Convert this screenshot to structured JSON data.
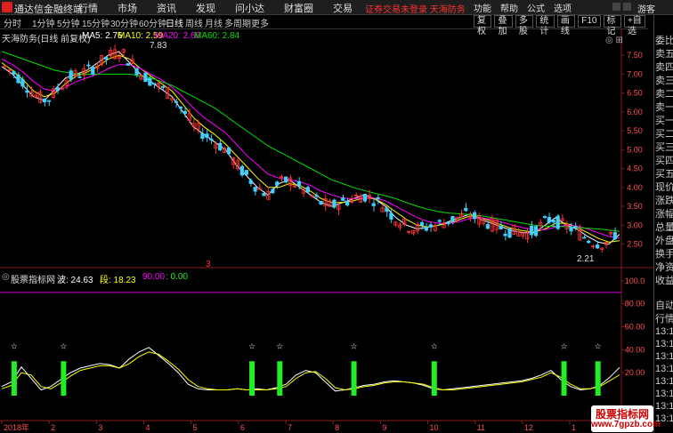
{
  "titlebar": {
    "app_title": "通达信金融终端",
    "menu": [
      "行情",
      "市场",
      "资讯",
      "发现",
      "问小达",
      "财富圈",
      "交易"
    ],
    "notice": "证券交易未登录 天海防务",
    "func": [
      "功能",
      "帮助",
      "公式",
      "选项"
    ],
    "guest": "游客"
  },
  "toolbar": {
    "periods": [
      "分时",
      "1分钟",
      "5分钟",
      "15分钟",
      "30分钟",
      "60分钟",
      "日线",
      "周线",
      "月线",
      "多周期",
      "更多"
    ],
    "active_period": "日线",
    "tools": [
      "复权",
      "叠加",
      "多股",
      "统计",
      "画线",
      "F10",
      "标记",
      "+自选"
    ]
  },
  "main_chart": {
    "title": "天海防务(日线 前复权)",
    "ma": [
      {
        "label": "MA5: 2.76",
        "color": "#ffffff"
      },
      {
        "label": "MA10: 2.59",
        "color": "#ffff00"
      },
      {
        "label": "MA20: 2.66",
        "color": "#ff00ff"
      },
      {
        "label": "MA60: 2.84",
        "color": "#00e000"
      }
    ],
    "high_label": "7.83",
    "low_label": "2.21",
    "marker": "3"
  },
  "indicator": {
    "title": "股票指标网",
    "wave": "波: 24.63",
    "segment": "段: 18.23",
    "l90": "90.00",
    "l0": ": 0.00"
  },
  "colors": {
    "up": "#ff3232",
    "down": "#40d0ff",
    "signal": "#22ee22",
    "background": "#000000"
  },
  "chart_data": [
    {
      "type": "line",
      "title": "天海防务(日线 前复权)",
      "y_ticks": [
        "7.50",
        "7.00",
        "6.50",
        "6.00",
        "5.50",
        "5.00",
        "4.50",
        "4.00",
        "3.50",
        "3.00",
        "2.50"
      ],
      "x_ticks": [
        "2018年",
        "2",
        "3",
        "4",
        "5",
        "6",
        "7",
        "8",
        "9",
        "10",
        "11",
        "12",
        "1"
      ],
      "ylim": [
        2.3,
        7.95
      ],
      "annotations": [
        {
          "label": "7.83",
          "x": 0.21,
          "y": 7.83
        },
        {
          "label": "2.21",
          "x": 0.96,
          "y": 2.21
        }
      ],
      "series": [
        {
          "name": "MA5",
          "values": [
            7.2,
            7.0,
            6.7,
            6.4,
            6.3,
            6.6,
            6.9,
            7.0,
            7.1,
            7.3,
            7.5,
            7.6,
            7.3,
            7.0,
            6.8,
            6.6,
            6.4,
            6.0,
            5.6,
            5.4,
            5.2,
            5.0,
            4.6,
            4.3,
            4.0,
            3.8,
            4.1,
            4.2,
            4.0,
            3.8,
            3.6,
            3.5,
            3.6,
            3.7,
            3.8,
            3.7,
            3.5,
            3.2,
            3.0,
            2.9,
            2.95,
            3.0,
            3.1,
            3.2,
            3.3,
            3.15,
            3.05,
            2.95,
            2.85,
            2.8,
            2.8,
            3.0,
            3.2,
            3.0,
            2.9,
            2.7,
            2.55,
            2.5,
            2.76
          ]
        },
        {
          "name": "MA10",
          "values": [
            7.3,
            7.1,
            6.85,
            6.55,
            6.4,
            6.5,
            6.75,
            6.95,
            7.05,
            7.2,
            7.4,
            7.5,
            7.4,
            7.15,
            6.95,
            6.75,
            6.55,
            6.2,
            5.85,
            5.6,
            5.4,
            5.15,
            4.85,
            4.55,
            4.25,
            4.0,
            4.0,
            4.1,
            4.05,
            3.9,
            3.7,
            3.6,
            3.6,
            3.65,
            3.72,
            3.7,
            3.55,
            3.35,
            3.15,
            3.0,
            2.95,
            3.0,
            3.05,
            3.15,
            3.25,
            3.2,
            3.1,
            3.0,
            2.9,
            2.85,
            2.82,
            2.9,
            3.05,
            3.05,
            2.95,
            2.8,
            2.65,
            2.55,
            2.59
          ]
        },
        {
          "name": "MA20",
          "values": [
            7.4,
            7.25,
            7.05,
            6.8,
            6.6,
            6.55,
            6.65,
            6.8,
            6.9,
            7.0,
            7.15,
            7.25,
            7.25,
            7.15,
            7.0,
            6.85,
            6.65,
            6.4,
            6.1,
            5.85,
            5.65,
            5.45,
            5.15,
            4.85,
            4.6,
            4.35,
            4.25,
            4.2,
            4.15,
            4.05,
            3.9,
            3.8,
            3.72,
            3.7,
            3.72,
            3.72,
            3.65,
            3.5,
            3.35,
            3.2,
            3.1,
            3.05,
            3.05,
            3.1,
            3.18,
            3.2,
            3.15,
            3.08,
            3.0,
            2.93,
            2.88,
            2.88,
            2.95,
            3.0,
            2.98,
            2.9,
            2.8,
            2.7,
            2.66
          ]
        },
        {
          "name": "MA60",
          "values": [
            7.6,
            7.5,
            7.4,
            7.3,
            7.2,
            7.1,
            7.05,
            7.0,
            7.0,
            7.0,
            7.0,
            7.0,
            7.0,
            6.95,
            6.9,
            6.8,
            6.7,
            6.55,
            6.4,
            6.25,
            6.1,
            5.9,
            5.7,
            5.5,
            5.3,
            5.1,
            4.95,
            4.8,
            4.65,
            4.5,
            4.35,
            4.2,
            4.1,
            4.0,
            3.92,
            3.85,
            3.78,
            3.7,
            3.6,
            3.5,
            3.42,
            3.36,
            3.32,
            3.3,
            3.28,
            3.25,
            3.2,
            3.15,
            3.1,
            3.05,
            3.0,
            2.98,
            2.97,
            2.96,
            2.94,
            2.92,
            2.9,
            2.87,
            2.84
          ]
        }
      ]
    },
    {
      "type": "line",
      "title": "股票指标网",
      "y_ticks": [
        "100.0",
        "80.00",
        "60.00",
        "40.00",
        "20.00"
      ],
      "ylim": [
        0,
        110
      ],
      "lines": [
        {
          "label": "90.00",
          "value": 90
        }
      ],
      "signals": [
        0.02,
        0.1,
        0.405,
        0.45,
        0.57,
        0.7,
        0.91,
        0.965
      ],
      "series": [
        {
          "name": "波",
          "values": [
            8,
            12,
            25,
            15,
            5,
            8,
            14,
            20,
            24,
            26,
            28,
            27,
            24,
            32,
            38,
            42,
            35,
            28,
            20,
            10,
            6,
            5,
            5,
            5,
            6,
            5,
            6,
            5,
            7,
            10,
            18,
            22,
            20,
            12,
            4,
            5,
            7,
            9,
            10,
            12,
            13,
            12,
            11,
            9,
            6,
            5,
            6,
            7,
            8,
            9,
            10,
            11,
            12,
            13,
            15,
            18,
            22,
            14,
            8,
            5,
            6,
            9,
            16,
            24.63
          ]
        },
        {
          "name": "段",
          "values": [
            6,
            9,
            20,
            18,
            8,
            6,
            11,
            17,
            22,
            24,
            26,
            26,
            24,
            28,
            34,
            38,
            36,
            30,
            23,
            14,
            8,
            6,
            5,
            5,
            6,
            5,
            5,
            5,
            6,
            8,
            15,
            20,
            21,
            15,
            7,
            5,
            6,
            8,
            9,
            11,
            12,
            12,
            11,
            10,
            7,
            5,
            5,
            6,
            7,
            8,
            9,
            10,
            11,
            12,
            14,
            16,
            20,
            16,
            10,
            6,
            6,
            8,
            13,
            18.23
          ]
        }
      ]
    }
  ]
}
